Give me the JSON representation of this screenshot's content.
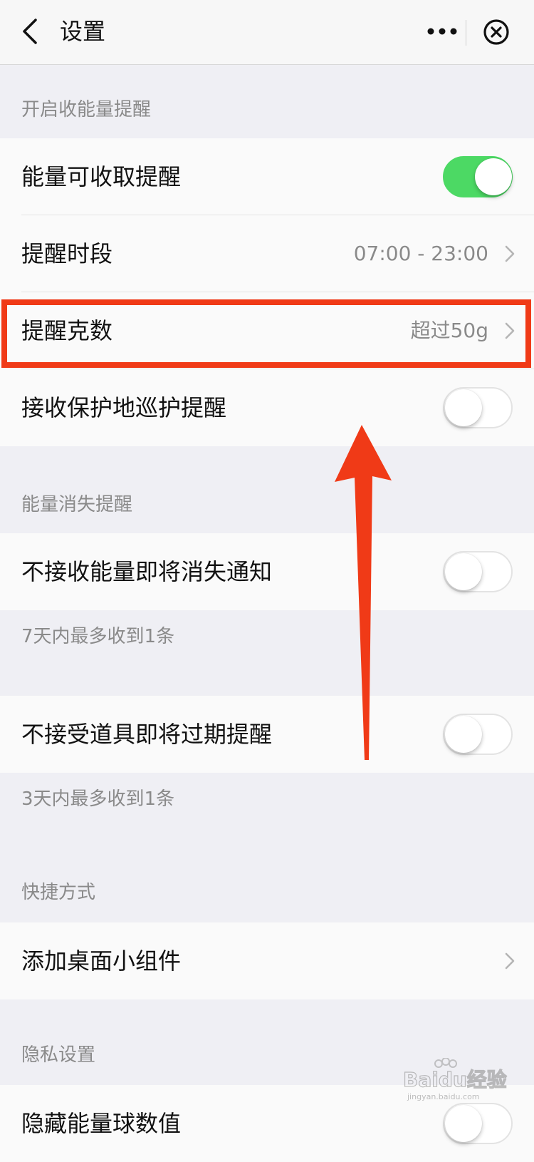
{
  "header": {
    "title": "设置"
  },
  "sections": {
    "energy_collect": {
      "label": "开启收能量提醒"
    },
    "energy_vanish": {
      "label": "能量消失提醒"
    },
    "shortcut": {
      "label": "快捷方式"
    },
    "privacy": {
      "label": "隐私设置"
    }
  },
  "rows": {
    "collectable_reminder": {
      "label": "能量可收取提醒",
      "toggle": "on"
    },
    "reminder_period": {
      "label": "提醒时段",
      "value": "07:00 - 23:00"
    },
    "reminder_grams": {
      "label": "提醒克数",
      "value": "超过50g"
    },
    "patrol_reminder": {
      "label": "接收保护地巡护提醒",
      "toggle": "off"
    },
    "vanish_notice": {
      "label": "不接收能量即将消失通知",
      "toggle": "off"
    },
    "item_expire": {
      "label": "不接受道具即将过期提醒",
      "toggle": "off"
    },
    "add_widget": {
      "label": "添加桌面小组件"
    },
    "hide_energy": {
      "label": "隐藏能量球数值",
      "toggle": "off"
    }
  },
  "notes": {
    "vanish_note": "7天内最多收到1条",
    "expire_note": "3天内最多收到1条"
  },
  "watermark": {
    "text": "Baidu经验",
    "sub": "jingyan.baidu.com"
  },
  "colors": {
    "toggle_on": "#4cd964",
    "highlight": "#f03a17",
    "background": "#efeff4"
  }
}
